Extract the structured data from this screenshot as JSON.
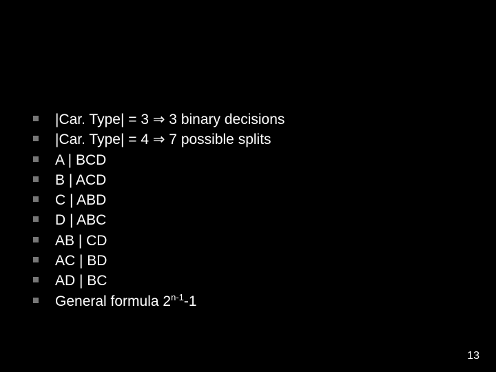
{
  "bullets": [
    {
      "pre": "|Car. Type| = 3 ",
      "arrow": "⇒",
      "post": " 3 binary decisions"
    },
    {
      "pre": "|Car. Type| = 4 ",
      "arrow": "⇒",
      "post": " 7 possible splits"
    },
    {
      "pre": "A | BCD",
      "arrow": "",
      "post": ""
    },
    {
      "pre": "B | ACD",
      "arrow": "",
      "post": ""
    },
    {
      "pre": "C | ABD",
      "arrow": "",
      "post": ""
    },
    {
      "pre": "D | ABC",
      "arrow": "",
      "post": ""
    },
    {
      "pre": "AB | CD",
      "arrow": "",
      "post": ""
    },
    {
      "pre": "AC | BD",
      "arrow": "",
      "post": ""
    },
    {
      "pre": "AD | BC",
      "arrow": "",
      "post": ""
    }
  ],
  "formula": {
    "prefix": "General formula  2",
    "exp1": "n-1",
    "suffix": "-1"
  },
  "page_number": "13"
}
